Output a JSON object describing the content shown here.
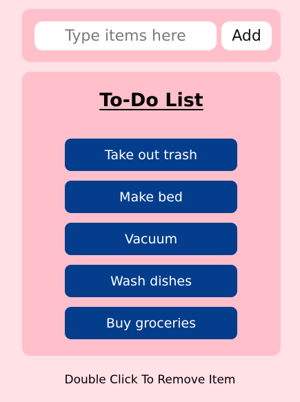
{
  "input_panel": {
    "placeholder": "Type items here",
    "value": "",
    "add_label": "Add"
  },
  "list_panel": {
    "title": "To-Do List",
    "items": [
      {
        "label": "Take out trash"
      },
      {
        "label": "Make bed"
      },
      {
        "label": "Vacuum"
      },
      {
        "label": "Wash dishes"
      },
      {
        "label": "Buy groceries"
      }
    ]
  },
  "hint": "Double Click To Remove Item",
  "colors": {
    "page_background": "#ffe1e6",
    "panel_background": "#ffc0cb",
    "item_background": "#043d8c",
    "item_text": "#ffffff"
  }
}
